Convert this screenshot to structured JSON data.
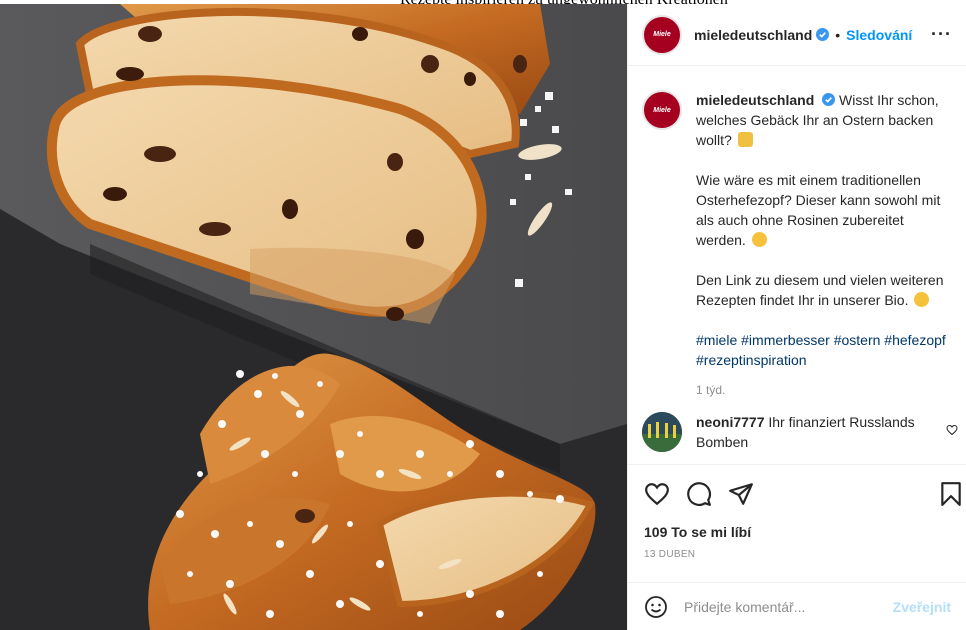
{
  "page_top_text": "Rezepte inspirieren zu ungewöhnlichen Kreationen",
  "post": {
    "author": "mieledeutschland",
    "avatar_text": "Miele",
    "follow_label": "Sledování",
    "dot": "•",
    "more_label": "···",
    "caption": {
      "line1": "Wisst Ihr schon, welches Gebäck Ihr an Ostern backen wollt?",
      "para2": "Wie wäre es mit einem traditionellen Osterhefezopf? Dieser kann sowohl mit als auch ohne Rosinen zubereitet werden.",
      "para3": "Den Link zu diesem und vielen weiteren Rezepten findet Ihr in unserer Bio.",
      "hashtags": "#miele #immerbesser #ostern #hefezopf #rezeptinspiration",
      "time": "1 týd."
    },
    "comment": {
      "user": "neoni7777",
      "text": "Ihr finanziert Russlands Bomben"
    },
    "likes": "109 To se mi líbí",
    "date": "13 DUBEN",
    "add_comment_placeholder": "Přidejte komentář...",
    "publish_label": "Zveřejnit"
  },
  "icons": {
    "verified": "verified-badge-icon",
    "like": "heart-icon",
    "comment": "comment-icon",
    "share": "paper-plane-icon",
    "save": "bookmark-icon",
    "emoji": "smiley-icon"
  },
  "colors": {
    "link_blue": "#0095f6",
    "hashtag": "#00376b",
    "miele_red": "#a5001f",
    "publish_disabled": "#b2dffc"
  }
}
